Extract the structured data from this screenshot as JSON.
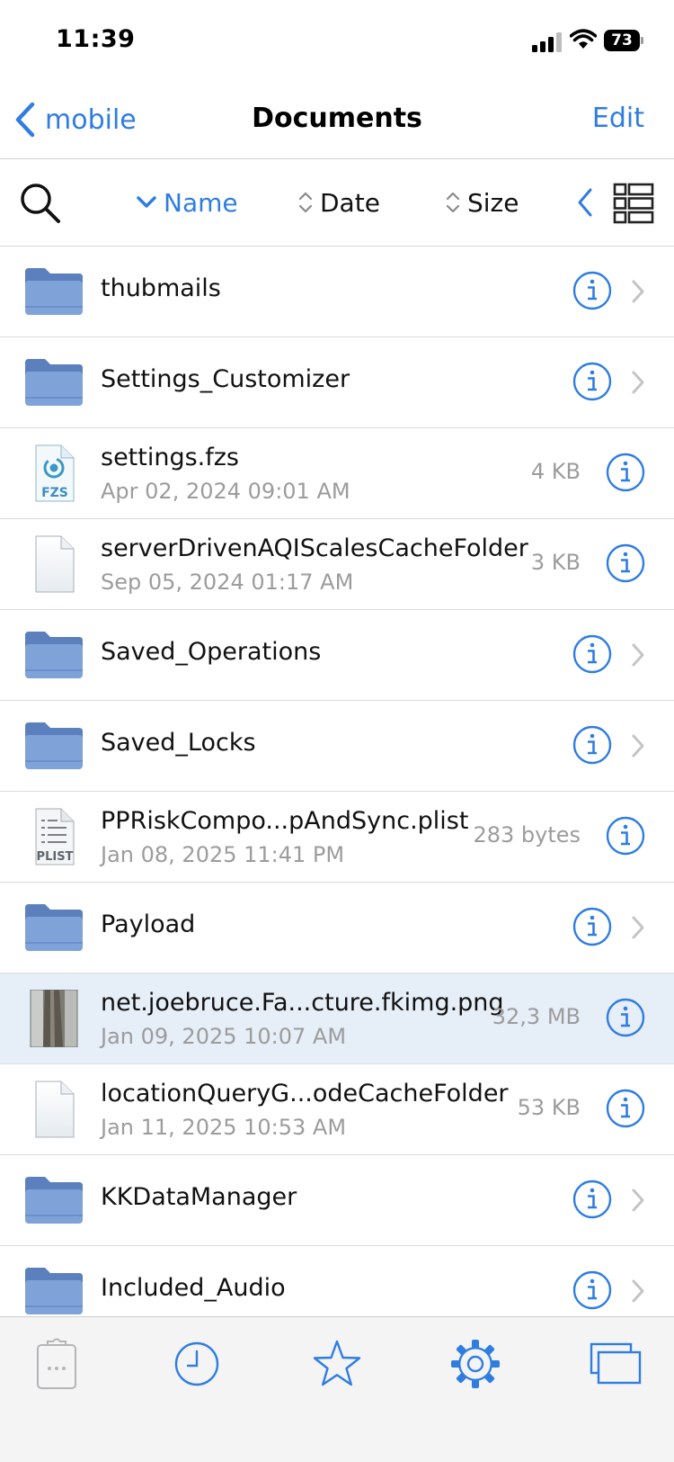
{
  "status_bar": {
    "time": "11:39",
    "battery": "73"
  },
  "nav": {
    "back_label": "mobile",
    "title": "Documents",
    "edit_label": "Edit"
  },
  "toolbar": {
    "sort_name": "Name",
    "sort_date": "Date",
    "sort_size": "Size",
    "active_sort": "Name"
  },
  "colors": {
    "accent": "#2f7de1",
    "folder": "#7fa3d9",
    "folder_dark": "#5b80bd",
    "selected_row": "#e6eef8"
  },
  "files": [
    {
      "name": "thubmails",
      "type": "folder",
      "icon": "folder-icon"
    },
    {
      "name": "Settings_Customizer",
      "type": "folder",
      "icon": "folder-icon"
    },
    {
      "name": "settings.fzs",
      "type": "file",
      "icon": "fzs-file-icon",
      "badge": "FZS",
      "date": "Apr 02, 2024 09:01 AM",
      "size": "4 KB"
    },
    {
      "name": "serverDrivenAQIScalesCacheFolder",
      "type": "file",
      "icon": "blank-file-icon",
      "date": "Sep 05, 2024 01:17 AM",
      "size": "3 KB"
    },
    {
      "name": "Saved_Operations",
      "type": "folder",
      "icon": "folder-icon"
    },
    {
      "name": "Saved_Locks",
      "type": "folder",
      "icon": "folder-icon"
    },
    {
      "name": "PPRiskCompo...pAndSync.plist",
      "type": "file",
      "icon": "plist-file-icon",
      "badge": "PLIST",
      "date": "Jan 08, 2025 11:41 PM",
      "size": "283 bytes"
    },
    {
      "name": "Payload",
      "type": "folder",
      "icon": "folder-icon"
    },
    {
      "name": "net.joebruce.Fa...cture.fkimg.png",
      "type": "file",
      "icon": "image-thumbnail",
      "date": "Jan 09, 2025 10:07 AM",
      "size": "32,3 MB",
      "selected": true
    },
    {
      "name": "locationQueryG...odeCacheFolder",
      "type": "file",
      "icon": "blank-file-icon",
      "date": "Jan 11, 2025 10:53 AM",
      "size": "53 KB"
    },
    {
      "name": "KKDataManager",
      "type": "folder",
      "icon": "folder-icon"
    },
    {
      "name": "Included_Audio",
      "type": "folder",
      "icon": "folder-icon"
    }
  ],
  "tabs": [
    {
      "name": "clipboard-tab",
      "icon": "clipboard-icon",
      "enabled": false
    },
    {
      "name": "recent-tab",
      "icon": "clock-icon",
      "enabled": true
    },
    {
      "name": "favorites-tab",
      "icon": "star-icon",
      "enabled": true
    },
    {
      "name": "settings-tab",
      "icon": "gear-icon",
      "enabled": true
    },
    {
      "name": "windows-tab",
      "icon": "windows-icon",
      "enabled": true
    }
  ]
}
